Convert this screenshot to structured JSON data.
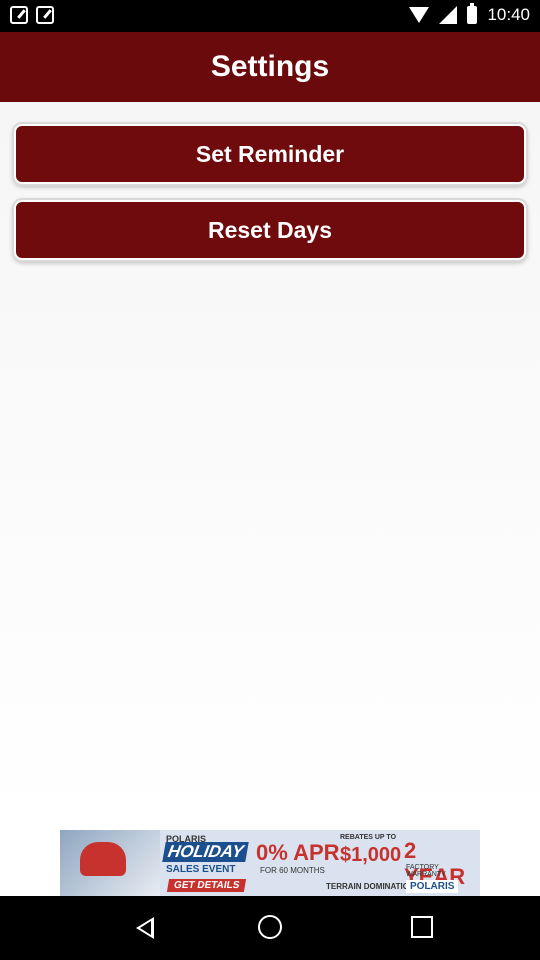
{
  "status_bar": {
    "time": "10:40",
    "left_icons": [
      "notification-icon",
      "notification-icon"
    ],
    "right_icons": [
      "wifi-icon",
      "signal-icon",
      "battery-icon"
    ]
  },
  "header": {
    "title": "Settings"
  },
  "buttons": {
    "set_reminder": "Set Reminder",
    "reset_days": "Reset Days"
  },
  "ad": {
    "brand_small": "POLARIS",
    "headline": "HOLIDAY",
    "sub_headline": "SALES EVENT",
    "apr": "0% APR",
    "apr_terms": "FOR 60 MONTHS",
    "rebate_label": "REBATES UP TO",
    "rebate_amount": "$1,000",
    "warranty": "2 YEAR",
    "warranty_label": "FACTORY WARRANTY",
    "cta": "GET DETAILS",
    "tagline": "TERRAIN DOMINATION",
    "logo": "POLARIS"
  },
  "nav_bar": {
    "icons": [
      "back-icon",
      "home-icon",
      "recents-icon"
    ]
  },
  "colors": {
    "accent": "#6b0a0d",
    "background": "#f6f6f6"
  }
}
